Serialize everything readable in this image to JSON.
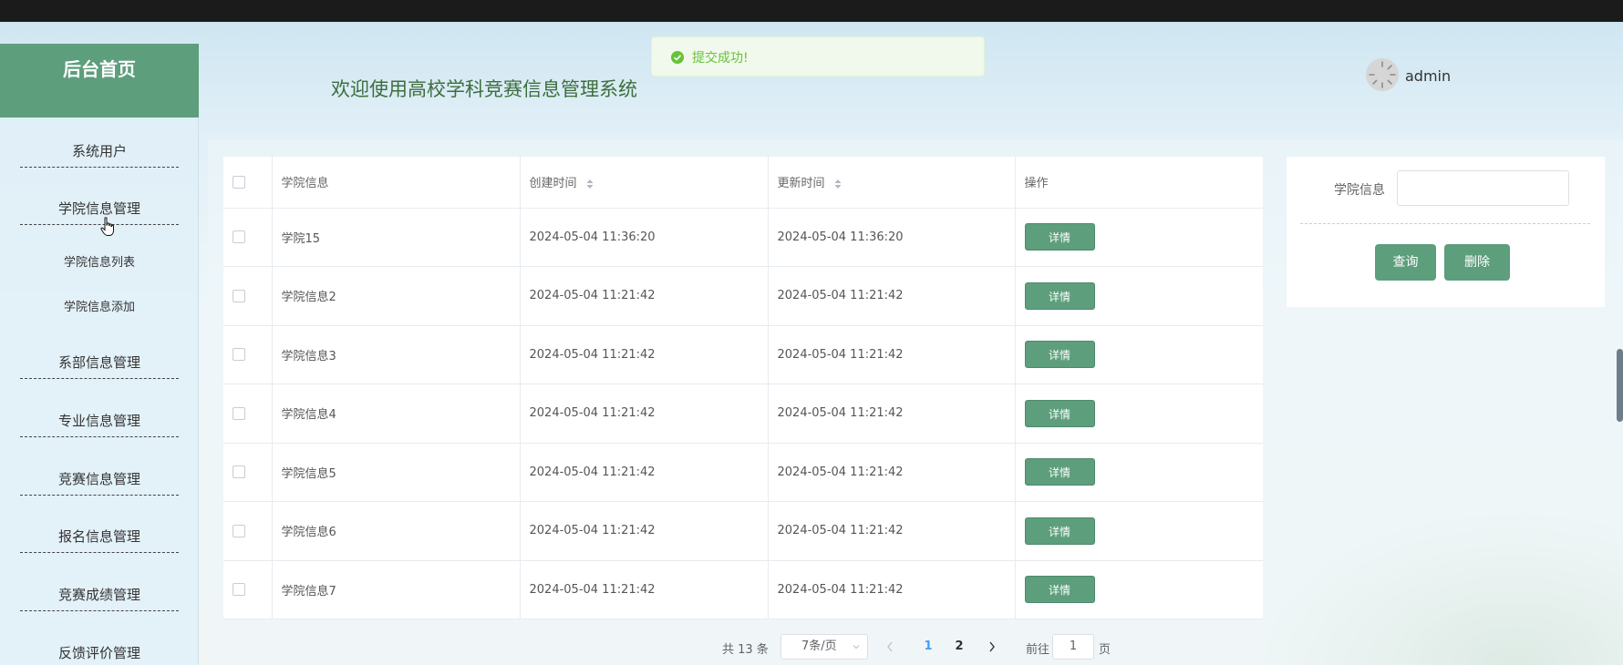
{
  "sidebar": {
    "title": "后台首页",
    "items": [
      {
        "label": "系统用户"
      },
      {
        "label": "学院信息管理"
      },
      {
        "label": "学院信息列表",
        "sub": true
      },
      {
        "label": "学院信息添加",
        "sub": true
      },
      {
        "label": "系部信息管理"
      },
      {
        "label": "专业信息管理"
      },
      {
        "label": "竞赛信息管理"
      },
      {
        "label": "报名信息管理"
      },
      {
        "label": "竞赛成绩管理"
      },
      {
        "label": "反馈评价管理"
      }
    ]
  },
  "header": {
    "title": "欢迎使用高校学科竞赛信息管理系统",
    "username": "admin"
  },
  "toast": {
    "message": "提交成功!",
    "color": "#67c23a"
  },
  "table": {
    "columns": [
      "学院信息",
      "创建时间",
      "更新时间",
      "操作"
    ],
    "rows": [
      {
        "name": "学院15",
        "created": "2024-05-04 11:36:20",
        "updated": "2024-05-04 11:36:20",
        "action": "详情"
      },
      {
        "name": "学院信息2",
        "created": "2024-05-04 11:21:42",
        "updated": "2024-05-04 11:21:42",
        "action": "详情"
      },
      {
        "name": "学院信息3",
        "created": "2024-05-04 11:21:42",
        "updated": "2024-05-04 11:21:42",
        "action": "详情"
      },
      {
        "name": "学院信息4",
        "created": "2024-05-04 11:21:42",
        "updated": "2024-05-04 11:21:42",
        "action": "详情"
      },
      {
        "name": "学院信息5",
        "created": "2024-05-04 11:21:42",
        "updated": "2024-05-04 11:21:42",
        "action": "详情"
      },
      {
        "name": "学院信息6",
        "created": "2024-05-04 11:21:42",
        "updated": "2024-05-04 11:21:42",
        "action": "详情"
      },
      {
        "name": "学院信息7",
        "created": "2024-05-04 11:21:42",
        "updated": "2024-05-04 11:21:42",
        "action": "详情"
      }
    ]
  },
  "pagination": {
    "total": "共 13 条",
    "page_size": "7条/页",
    "pages": [
      "1",
      "2"
    ],
    "current_page": "1",
    "goto_label": "前往",
    "goto_value": "1",
    "goto_unit": "页"
  },
  "search": {
    "label": "学院信息",
    "value": "",
    "query_button": "查询",
    "delete_button": "删除"
  },
  "colors": {
    "accent": "#5d9e7c",
    "active_page": "#409eff"
  }
}
